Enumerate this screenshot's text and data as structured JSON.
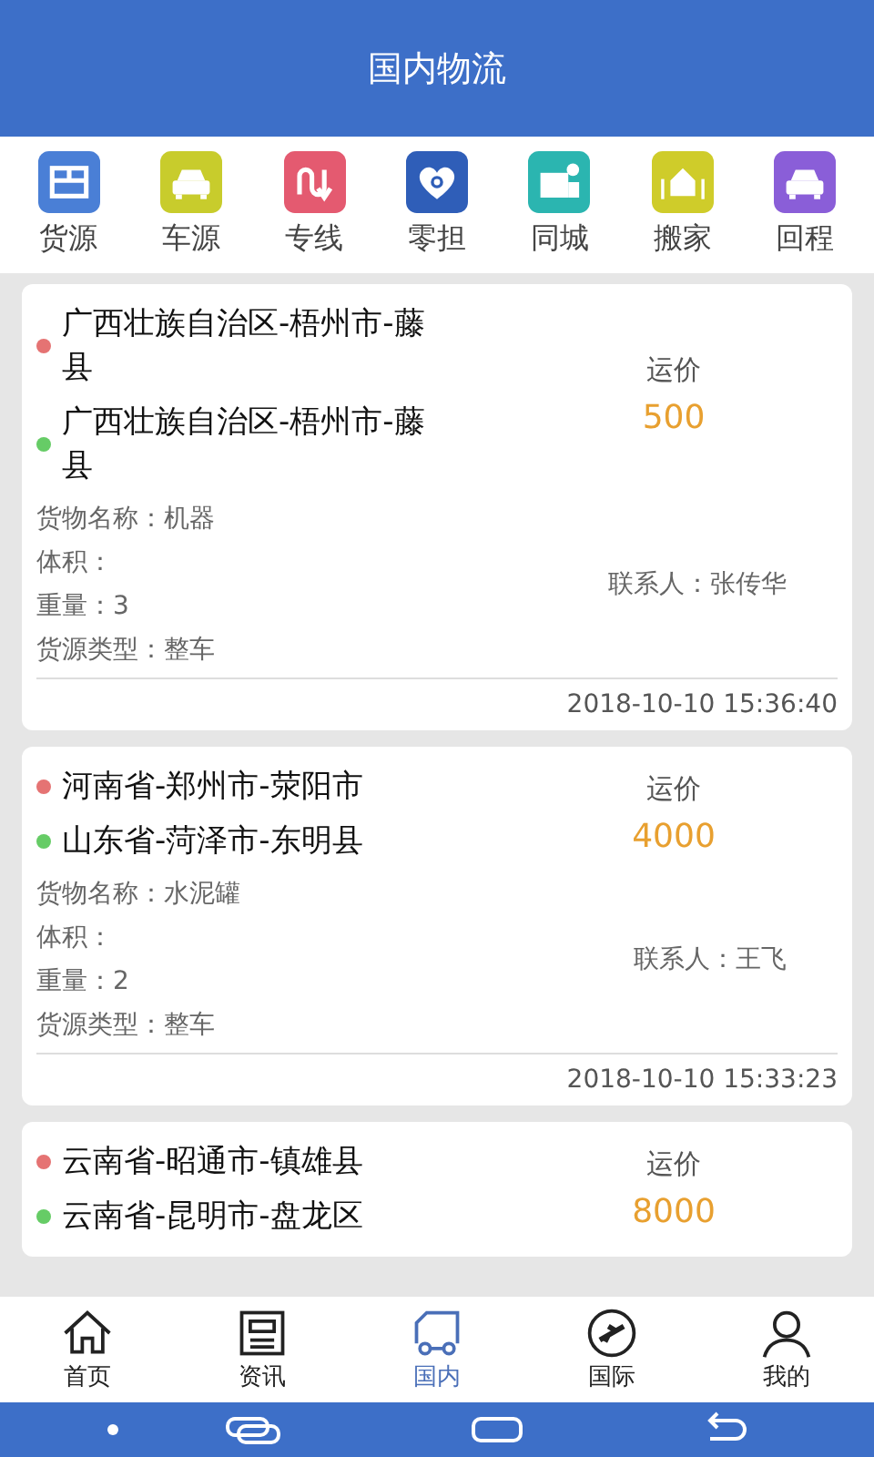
{
  "header": {
    "title": "国内物流"
  },
  "categories": [
    {
      "label": "货源",
      "color": "#4a7fd6",
      "kind": "box"
    },
    {
      "label": "车源",
      "color": "#c8cc2c",
      "kind": "car"
    },
    {
      "label": "专线",
      "color": "#e45a70",
      "kind": "route"
    },
    {
      "label": "零担",
      "color": "#2f5eb8",
      "kind": "heart"
    },
    {
      "label": "同城",
      "color": "#2bb5b0",
      "kind": "city"
    },
    {
      "label": "搬家",
      "color": "#cfcc2a",
      "kind": "house"
    },
    {
      "label": "回程",
      "color": "#8a5ed8",
      "kind": "car"
    }
  ],
  "listings": [
    {
      "from": "广西壮族自治区-梧州市-藤县",
      "to": "广西壮族自治区-梧州市-藤县",
      "price_label": "运价",
      "price": "500",
      "details": [
        "货物名称：机器",
        "体积：",
        "重量：3",
        "货源类型：整车"
      ],
      "contact": "联系人：张传华",
      "time": "2018-10-10 15:36:40"
    },
    {
      "from": "河南省-郑州市-荥阳市",
      "to": "山东省-菏泽市-东明县",
      "price_label": "运价",
      "price": "4000",
      "details": [
        "货物名称：水泥罐",
        "体积：",
        "重量：2",
        "货源类型：整车"
      ],
      "contact": "联系人：王飞",
      "time": "2018-10-10 15:33:23"
    },
    {
      "from": "云南省-昭通市-镇雄县",
      "to": "云南省-昆明市-盘龙区",
      "price_label": "运价",
      "price": "8000"
    }
  ],
  "tab_bar": [
    {
      "label": "首页",
      "kind": "home",
      "selected": false
    },
    {
      "label": "资讯",
      "kind": "news",
      "selected": false
    },
    {
      "label": "国内",
      "kind": "truck",
      "selected": true
    },
    {
      "label": "国际",
      "kind": "plane",
      "selected": false
    },
    {
      "label": "我的",
      "kind": "person",
      "selected": false
    }
  ]
}
